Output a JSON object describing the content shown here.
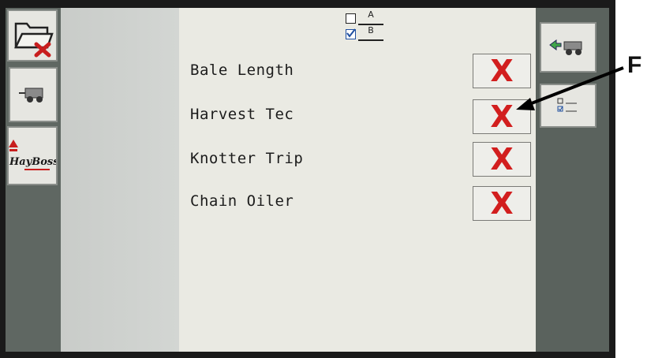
{
  "header": {
    "option_a": "A",
    "option_b": "B",
    "option_a_checked": false,
    "option_b_checked": true
  },
  "sidebar_left": {
    "items": [
      {
        "icon": "folder-delete-icon"
      },
      {
        "icon": "baler-icon"
      },
      {
        "icon": "hayboss-logo",
        "logo_text": "HayBoss"
      }
    ]
  },
  "sidebar_right": {
    "items": [
      {
        "icon": "back-to-baler-icon"
      },
      {
        "icon": "ab-config-icon"
      }
    ]
  },
  "rows": [
    {
      "label": "Bale Length",
      "status": "X"
    },
    {
      "label": "Harvest Tec",
      "status": "X"
    },
    {
      "label": "Knotter Trip",
      "status": "X"
    },
    {
      "label": "Chain Oiler",
      "status": "X"
    }
  ],
  "annotation": {
    "callout": "F"
  },
  "colors": {
    "x_red": "#d21e1e",
    "arrow_green": "#3fa648"
  }
}
